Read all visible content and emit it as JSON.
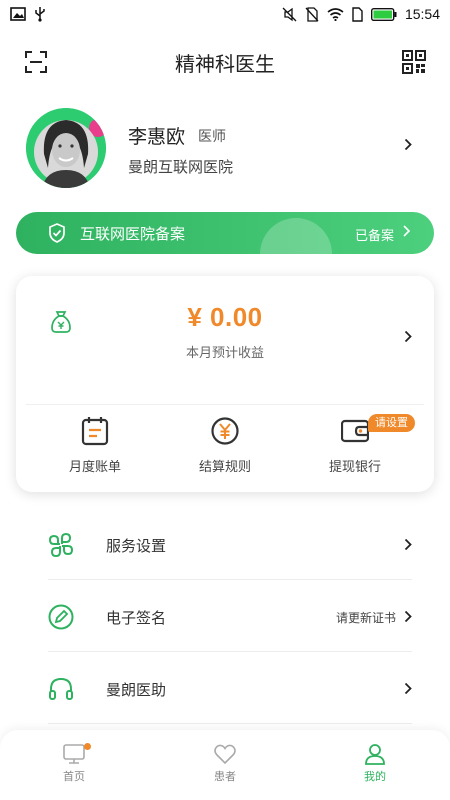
{
  "status_bar": {
    "time": "15:54",
    "icons": [
      "image-icon",
      "usb-icon",
      "mute-icon",
      "no-sim-icon",
      "wifi-icon",
      "sim-icon",
      "battery-icon"
    ]
  },
  "header": {
    "title": "精神科医生",
    "left_icon": "scan-icon",
    "right_icon": "qr-code-icon"
  },
  "profile": {
    "name": "李惠欧",
    "title": "医师",
    "hospital": "曼朗互联网医院"
  },
  "record": {
    "label": "互联网医院备案",
    "status": "已备案"
  },
  "income": {
    "amount": "¥ 0.00",
    "label": "本月预计收益",
    "shortcuts": [
      {
        "label": "月度账单",
        "icon": "calendar-bill-icon"
      },
      {
        "label": "结算规则",
        "icon": "yuan-coin-icon"
      },
      {
        "label": "提现银行",
        "icon": "wallet-icon",
        "badge": "请设置"
      }
    ]
  },
  "menu": [
    {
      "label": "服务设置",
      "icon": "clover-icon",
      "note": ""
    },
    {
      "label": "电子签名",
      "icon": "pen-circle-icon",
      "note": "请更新证书"
    },
    {
      "label": "曼朗医助",
      "icon": "headset-icon",
      "note": ""
    }
  ],
  "tabs": [
    {
      "label": "首页",
      "icon": "monitor-icon",
      "active": false
    },
    {
      "label": "患者",
      "icon": "heart-icon",
      "active": false
    },
    {
      "label": "我的",
      "icon": "person-icon",
      "active": true
    }
  ],
  "colors": {
    "brand_green": "#2eb25f",
    "accent_orange": "#f0892a"
  }
}
